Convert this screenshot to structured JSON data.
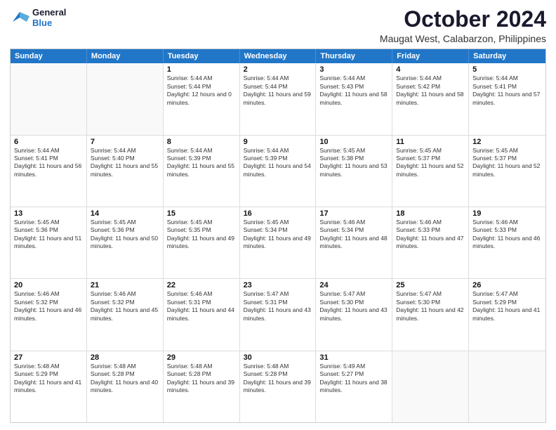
{
  "logo": {
    "line1": "General",
    "line2": "Blue"
  },
  "title": "October 2024",
  "subtitle": "Maugat West, Calabarzon, Philippines",
  "days": [
    "Sunday",
    "Monday",
    "Tuesday",
    "Wednesday",
    "Thursday",
    "Friday",
    "Saturday"
  ],
  "weeks": [
    [
      {
        "num": "",
        "text": ""
      },
      {
        "num": "",
        "text": ""
      },
      {
        "num": "1",
        "text": "Sunrise: 5:44 AM\nSunset: 5:44 PM\nDaylight: 12 hours and 0 minutes."
      },
      {
        "num": "2",
        "text": "Sunrise: 5:44 AM\nSunset: 5:44 PM\nDaylight: 11 hours and 59 minutes."
      },
      {
        "num": "3",
        "text": "Sunrise: 5:44 AM\nSunset: 5:43 PM\nDaylight: 11 hours and 58 minutes."
      },
      {
        "num": "4",
        "text": "Sunrise: 5:44 AM\nSunset: 5:42 PM\nDaylight: 11 hours and 58 minutes."
      },
      {
        "num": "5",
        "text": "Sunrise: 5:44 AM\nSunset: 5:41 PM\nDaylight: 11 hours and 57 minutes."
      }
    ],
    [
      {
        "num": "6",
        "text": "Sunrise: 5:44 AM\nSunset: 5:41 PM\nDaylight: 11 hours and 56 minutes."
      },
      {
        "num": "7",
        "text": "Sunrise: 5:44 AM\nSunset: 5:40 PM\nDaylight: 11 hours and 55 minutes."
      },
      {
        "num": "8",
        "text": "Sunrise: 5:44 AM\nSunset: 5:39 PM\nDaylight: 11 hours and 55 minutes."
      },
      {
        "num": "9",
        "text": "Sunrise: 5:44 AM\nSunset: 5:39 PM\nDaylight: 11 hours and 54 minutes."
      },
      {
        "num": "10",
        "text": "Sunrise: 5:45 AM\nSunset: 5:38 PM\nDaylight: 11 hours and 53 minutes."
      },
      {
        "num": "11",
        "text": "Sunrise: 5:45 AM\nSunset: 5:37 PM\nDaylight: 11 hours and 52 minutes."
      },
      {
        "num": "12",
        "text": "Sunrise: 5:45 AM\nSunset: 5:37 PM\nDaylight: 11 hours and 52 minutes."
      }
    ],
    [
      {
        "num": "13",
        "text": "Sunrise: 5:45 AM\nSunset: 5:36 PM\nDaylight: 11 hours and 51 minutes."
      },
      {
        "num": "14",
        "text": "Sunrise: 5:45 AM\nSunset: 5:36 PM\nDaylight: 11 hours and 50 minutes."
      },
      {
        "num": "15",
        "text": "Sunrise: 5:45 AM\nSunset: 5:35 PM\nDaylight: 11 hours and 49 minutes."
      },
      {
        "num": "16",
        "text": "Sunrise: 5:45 AM\nSunset: 5:34 PM\nDaylight: 11 hours and 49 minutes."
      },
      {
        "num": "17",
        "text": "Sunrise: 5:46 AM\nSunset: 5:34 PM\nDaylight: 11 hours and 48 minutes."
      },
      {
        "num": "18",
        "text": "Sunrise: 5:46 AM\nSunset: 5:33 PM\nDaylight: 11 hours and 47 minutes."
      },
      {
        "num": "19",
        "text": "Sunrise: 5:46 AM\nSunset: 5:33 PM\nDaylight: 11 hours and 46 minutes."
      }
    ],
    [
      {
        "num": "20",
        "text": "Sunrise: 5:46 AM\nSunset: 5:32 PM\nDaylight: 11 hours and 46 minutes."
      },
      {
        "num": "21",
        "text": "Sunrise: 5:46 AM\nSunset: 5:32 PM\nDaylight: 11 hours and 45 minutes."
      },
      {
        "num": "22",
        "text": "Sunrise: 5:46 AM\nSunset: 5:31 PM\nDaylight: 11 hours and 44 minutes."
      },
      {
        "num": "23",
        "text": "Sunrise: 5:47 AM\nSunset: 5:31 PM\nDaylight: 11 hours and 43 minutes."
      },
      {
        "num": "24",
        "text": "Sunrise: 5:47 AM\nSunset: 5:30 PM\nDaylight: 11 hours and 43 minutes."
      },
      {
        "num": "25",
        "text": "Sunrise: 5:47 AM\nSunset: 5:30 PM\nDaylight: 11 hours and 42 minutes."
      },
      {
        "num": "26",
        "text": "Sunrise: 5:47 AM\nSunset: 5:29 PM\nDaylight: 11 hours and 41 minutes."
      }
    ],
    [
      {
        "num": "27",
        "text": "Sunrise: 5:48 AM\nSunset: 5:29 PM\nDaylight: 11 hours and 41 minutes."
      },
      {
        "num": "28",
        "text": "Sunrise: 5:48 AM\nSunset: 5:28 PM\nDaylight: 11 hours and 40 minutes."
      },
      {
        "num": "29",
        "text": "Sunrise: 5:48 AM\nSunset: 5:28 PM\nDaylight: 11 hours and 39 minutes."
      },
      {
        "num": "30",
        "text": "Sunrise: 5:48 AM\nSunset: 5:28 PM\nDaylight: 11 hours and 39 minutes."
      },
      {
        "num": "31",
        "text": "Sunrise: 5:49 AM\nSunset: 5:27 PM\nDaylight: 11 hours and 38 minutes."
      },
      {
        "num": "",
        "text": ""
      },
      {
        "num": "",
        "text": ""
      }
    ]
  ]
}
